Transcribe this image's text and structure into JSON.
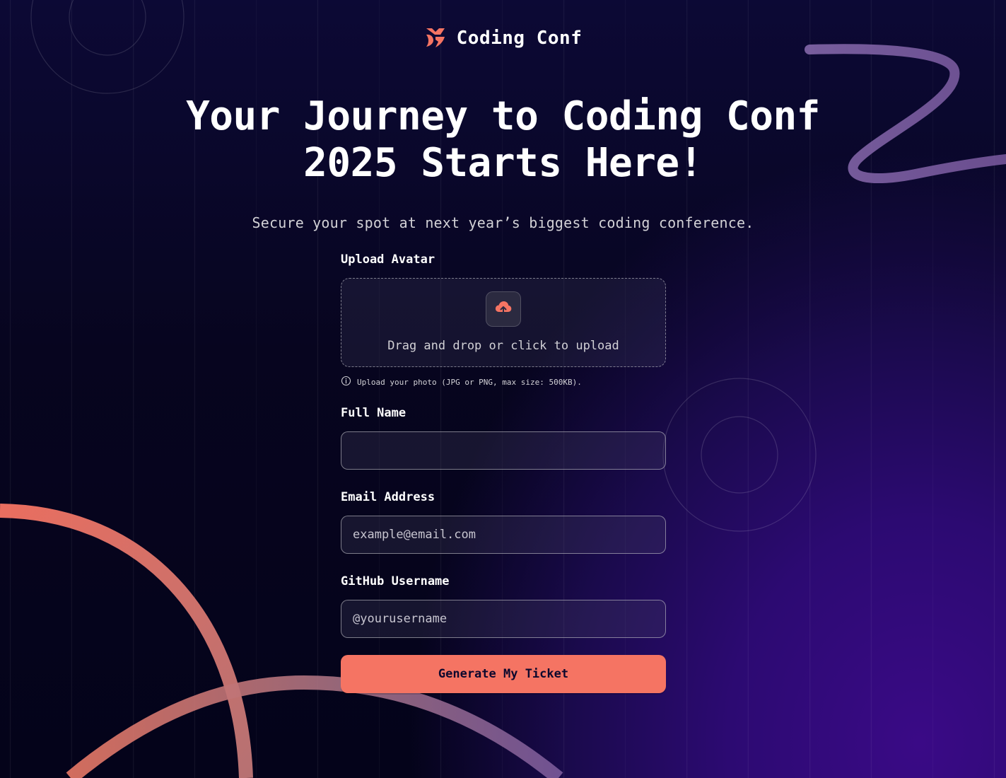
{
  "brand": {
    "name": "Coding Conf",
    "logo_icon": "coding-conf-logo-icon",
    "accent_color": "#f57463"
  },
  "hero": {
    "headline_line1": "Your Journey to Coding Conf",
    "headline_line2": "2025 Starts Here!",
    "subheadline": "Secure your spot at next year’s biggest coding conference."
  },
  "form": {
    "avatar": {
      "label": "Upload Avatar",
      "dropzone_text": "Drag and drop or click to upload",
      "icon": "upload-cloud-icon",
      "hint_icon": "info-icon",
      "hint": "Upload your photo (JPG or PNG, max size: 500KB)."
    },
    "full_name": {
      "label": "Full Name",
      "value": "",
      "placeholder": ""
    },
    "email": {
      "label": "Email Address",
      "value": "",
      "placeholder": "example@email.com"
    },
    "github": {
      "label": "GitHub Username",
      "value": "",
      "placeholder": "@yourusername"
    },
    "submit_label": "Generate My Ticket"
  }
}
